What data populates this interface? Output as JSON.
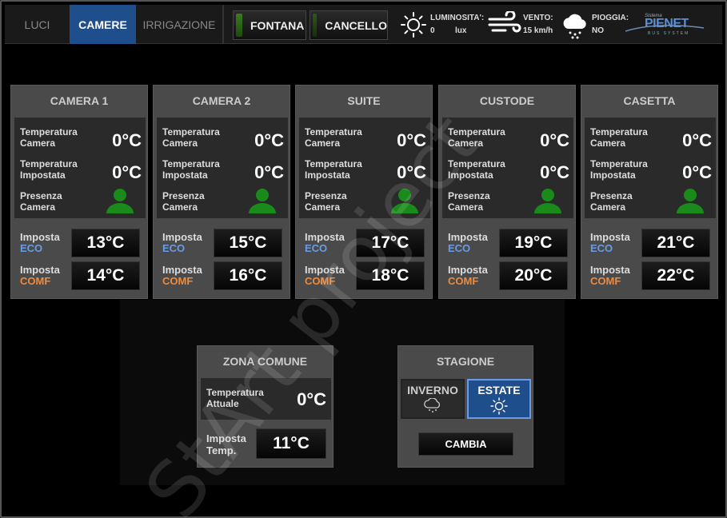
{
  "tabs": [
    {
      "label": "LUCI",
      "active": false
    },
    {
      "label": "CAMERE",
      "active": true
    },
    {
      "label": "IRRIGAZIONE",
      "active": false
    }
  ],
  "devices": {
    "fontana": "FONTANA",
    "cancello": "CANCELLO"
  },
  "weather": {
    "luminosita_label": "LUMINOSITA':",
    "luminosita_value": "0",
    "luminosita_unit": "lux",
    "vento_label": "VENTO:",
    "vento_value": "15 km/h",
    "pioggia_label": "PIOGGIA:",
    "pioggia_value": "NO"
  },
  "logo": {
    "top": "Sistema",
    "main": "PIENET",
    "sub": "BUS SYSTEM"
  },
  "labels": {
    "temp_camera_1": "Temperatura",
    "temp_camera_2": "Camera",
    "temp_imp_1": "Temperatura",
    "temp_imp_2": "Impostata",
    "presenza_1": "Presenza",
    "presenza_2": "Camera",
    "imposta": "Imposta",
    "eco": "ECO",
    "comf": "COMF"
  },
  "rooms": [
    {
      "name": "CAMERA 1",
      "temp_camera": "0°C",
      "temp_impostata": "0°C",
      "eco": "13°C",
      "comf": "14°C"
    },
    {
      "name": "CAMERA 2",
      "temp_camera": "0°C",
      "temp_impostata": "0°C",
      "eco": "15°C",
      "comf": "16°C"
    },
    {
      "name": "SUITE",
      "temp_camera": "0°C",
      "temp_impostata": "0°C",
      "eco": "17°C",
      "comf": "18°C"
    },
    {
      "name": "CUSTODE",
      "temp_camera": "0°C",
      "temp_impostata": "0°C",
      "eco": "19°C",
      "comf": "20°C"
    },
    {
      "name": "CASETTA",
      "temp_camera": "0°C",
      "temp_impostata": "0°C",
      "eco": "21°C",
      "comf": "22°C"
    }
  ],
  "zona": {
    "title": "ZONA COMUNE",
    "temp_label_1": "Temperatura",
    "temp_label_2": "Attuale",
    "temp_value": "0°C",
    "imposta_label_1": "Imposta",
    "imposta_label_2": "Temp.",
    "imposta_value": "11°C"
  },
  "stagione": {
    "title": "STAGIONE",
    "inverno": "INVERNO",
    "estate": "ESTATE",
    "active": "ESTATE",
    "cambia": "CAMBIA"
  },
  "watermark": "StArt project",
  "colors": {
    "accent_blue": "#1f4e8c",
    "eco": "#6a9be6",
    "comf": "#f08a3c",
    "presence_green": "#1a8a1a"
  }
}
